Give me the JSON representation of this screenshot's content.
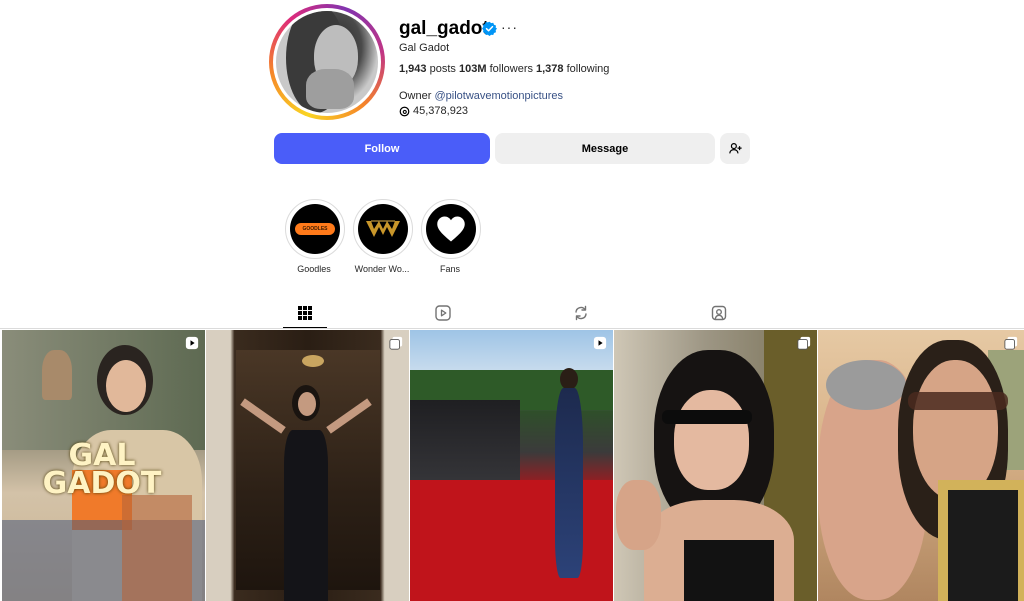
{
  "profile": {
    "username": "gal_gadot",
    "full_name": "Gal Gadot",
    "more_label": "···",
    "stats": {
      "posts_count": "1,943",
      "posts_label": "posts",
      "followers_count": "103M",
      "followers_label": "followers",
      "following_count": "1,378",
      "following_label": "following"
    },
    "bio_prefix": "Owner",
    "bio_tag": "@pilotwavemotionpictures",
    "threads_count": "45,378,923"
  },
  "actions": {
    "follow_label": "Follow",
    "message_label": "Message"
  },
  "highlights": [
    {
      "label": "Goodles",
      "icon": "goodles-logo"
    },
    {
      "label": "Wonder Wo...",
      "icon": "wonder-woman-logo"
    },
    {
      "label": "Fans",
      "icon": "heart-icon"
    }
  ],
  "highlight_logo_text": "GOODLES",
  "tabs": [
    "grid-icon",
    "reels-icon",
    "reposts-icon",
    "tagged-icon"
  ],
  "posts": [
    {
      "overlay_line1": "GAL",
      "overlay_line2": "GADOT",
      "badge": "reel-icon"
    },
    {
      "badge": "carousel-icon"
    },
    {
      "badge": "reel-icon"
    },
    {
      "badge": "carousel-icon"
    },
    {
      "badge": "carousel-icon"
    }
  ],
  "colors": {
    "follow_button": "#4a5df9",
    "verified_badge": "#0095f6",
    "link": "#385185"
  }
}
